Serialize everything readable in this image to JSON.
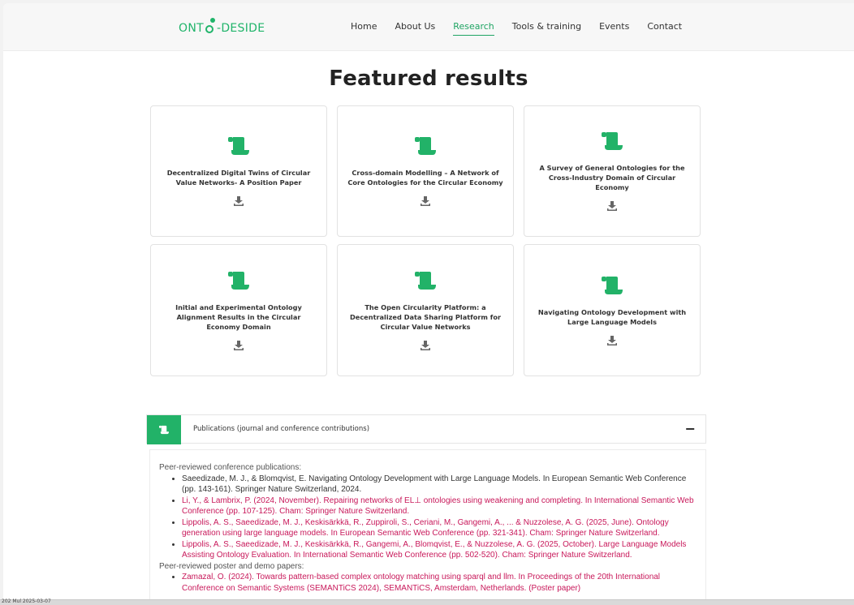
{
  "header": {
    "logo": {
      "left": "ONT",
      "right": "DESIDE"
    },
    "nav": [
      {
        "label": "Home",
        "active": false
      },
      {
        "label": "About Us",
        "active": false
      },
      {
        "label": "Research",
        "active": true
      },
      {
        "label": "Tools & training",
        "active": false
      },
      {
        "label": "Events",
        "active": false
      },
      {
        "label": "Contact",
        "active": false
      }
    ]
  },
  "page_title": "Featured results",
  "cards": [
    {
      "title": "Decentralized Digital Twins of Circular Value Networks- A Position Paper",
      "icon": "scroll-icon",
      "download_icon": "download-icon"
    },
    {
      "title": "Cross-domain Modelling – A Network of Core Ontologies for the Circular Economy",
      "icon": "scroll-icon",
      "download_icon": "download-icon"
    },
    {
      "title": "A Survey of General Ontologies for the Cross-Industry Domain of Circular Economy",
      "icon": "scroll-icon",
      "download_icon": "download-icon"
    },
    {
      "title": "Initial and Experimental Ontology Alignment Results in the Circular Economy Domain",
      "icon": "scroll-icon",
      "download_icon": "download-icon"
    },
    {
      "title": "The Open Circularity Platform: a Decentralized Data Sharing Platform for Circular Value Networks",
      "icon": "scroll-icon",
      "download_icon": "download-icon"
    },
    {
      "title": "Navigating Ontology Development with Large Language Models",
      "icon": "scroll-icon",
      "download_icon": "download-icon"
    }
  ],
  "accordion": {
    "title": "Publications (journal and conference contributions)",
    "toggle": "−",
    "icon": "scroll-icon"
  },
  "publications": {
    "conference_heading": "Peer-reviewed conference publications:",
    "conference_items": [
      "Saeedizade, M. J., & Blomqvist, E. Navigating Ontology Development with Large Language Models. In European Semantic Web Conference (pp. 143-161). Springer Nature Switzerland, 2024.",
      "Li, Y., & Lambrix, P. (2024, November). Repairing networks of EL⊥ ontologies using weakening and completing. In International Semantic Web Conference (pp. 107-125). Cham: Springer Nature Switzerland.",
      "Lippolis, A. S., Saeedizade, M. J., Keskisärkkä, R., Zuppiroli, S., Ceriani, M., Gangemi, A., ... & Nuzzolese, A. G. (2025, June). Ontology generation using large language models. In European Semantic Web Conference (pp. 321-341). Cham: Springer Nature Switzerland.",
      "Lippolis, A. S., Saeedizade, M. J., Keskisärkkä, R., Gangemi, A., Blomqvist, E., & Nuzzolese, A. G. (2025, October). Large Language Models Assisting Ontology Evaluation. In International Semantic Web Conference (pp. 502-520). Cham: Springer Nature Switzerland."
    ],
    "poster_heading": "Peer-reviewed poster and demo papers:",
    "poster_items": [
      "Zamazal, O. (2024). Towards pattern-based complex ontology matching using sparql and llm. In Proceedings of the 20th International Conference on Semantic Systems (SEMANTiCS 2024), SEMANTiCS, Amsterdam, Netherlands. (Poster paper)"
    ]
  },
  "taskbar": {
    "text": "202 Mul 2025-03-07"
  },
  "colors": {
    "brand": "#20b46a",
    "link_red": "#c8185a",
    "nav_active": "#1fa463"
  }
}
